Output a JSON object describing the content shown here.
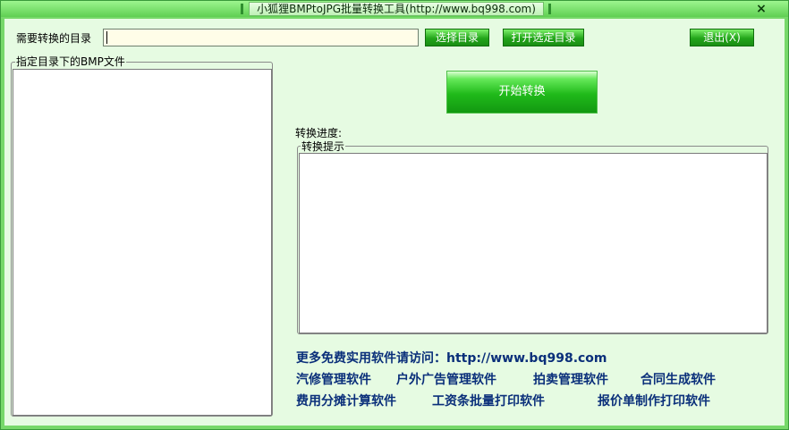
{
  "window": {
    "title": "小狐狸BMPtoJPG批量转换工具(http://www.bq998.com)",
    "close_glyph": "×"
  },
  "dir_row": {
    "label": "需要转换的目录",
    "path_value": "",
    "select_button": "选择目录",
    "open_button": "打开选定目录",
    "exit_button": "退出(X)"
  },
  "file_group": {
    "title": "指定目录下的BMP文件",
    "items": []
  },
  "convert": {
    "start_button": "开始转换",
    "progress_label": "转换进度:",
    "hint_group_title": "转换提示",
    "hint_text": ""
  },
  "promo": {
    "visit_line": "更多免费实用软件请访问：http://www.bq998.com",
    "row1": [
      "汽修管理软件",
      "户外广告管理软件",
      "拍卖管理软件",
      "合同生成软件"
    ],
    "row2": [
      "费用分摊计算软件",
      "工资条批量打印软件",
      "报价单制作打印软件"
    ]
  },
  "colors": {
    "frame": "#77d86a",
    "client_bg": "#e6fbe2",
    "button_green": "#22a51a",
    "link_blue": "#0a2f7a"
  }
}
